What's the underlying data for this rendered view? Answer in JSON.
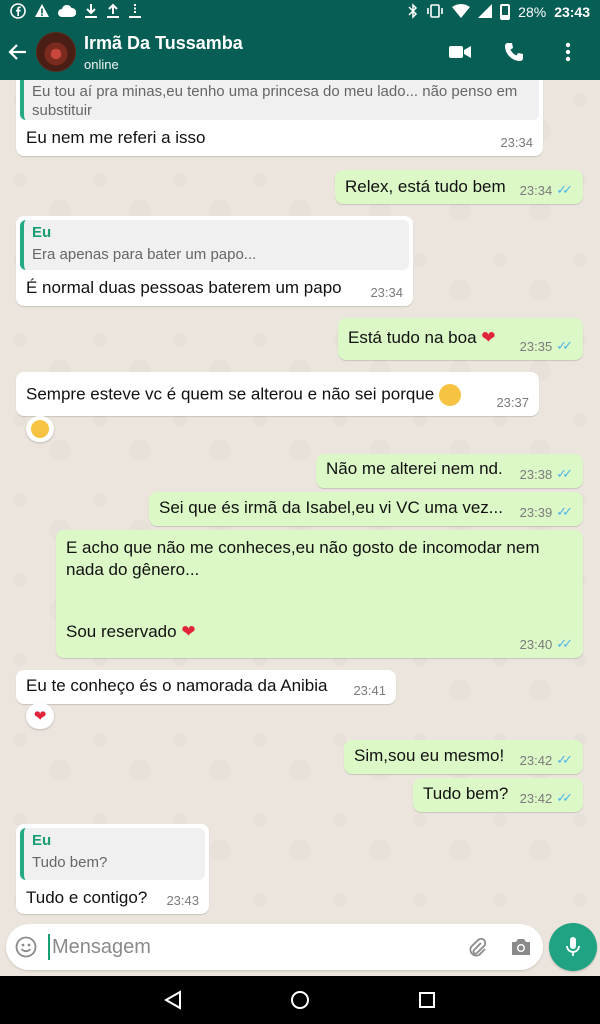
{
  "statusbar": {
    "battery": "28%",
    "time": "23:43",
    "left_icons": [
      "facebook-icon",
      "warning-icon",
      "cloud-icon",
      "download-icon",
      "download-icon",
      "upload-icon",
      "download-icon"
    ],
    "right_icons": [
      "bluetooth-icon",
      "vibrate-icon",
      "wifi-icon",
      "signal-icon",
      "battery-icon"
    ]
  },
  "header": {
    "contact_name": "Irmã Da Tussamba",
    "status": "online"
  },
  "messages": [
    {
      "type": "incoming",
      "quote_text": "Eu tou aí pra minas,eu tenho uma princesa do meu lado... não penso em substituir",
      "text": "Eu nem me referi a isso",
      "time": "23:34"
    },
    {
      "type": "outgoing",
      "text": "Relex, está tudo bem",
      "time": "23:34"
    },
    {
      "type": "incoming",
      "quote_name": "Eu",
      "quote_text": "Era apenas para bater um papo...",
      "text": "É normal duas pessoas baterem um papo",
      "time": "23:34"
    },
    {
      "type": "outgoing",
      "text": "Está tudo na boa",
      "time": "23:35"
    },
    {
      "type": "incoming",
      "text": "Sempre esteve vc é quem se alterou e não sei porque",
      "time": "23:37"
    },
    {
      "type": "outgoing",
      "text": "Não me alterei nem nd.",
      "time": "23:38"
    },
    {
      "type": "outgoing",
      "text": "Sei que és irmã da Isabel,eu vi VC uma vez...",
      "time": "23:39"
    },
    {
      "type": "outgoing",
      "text_line1": "E acho que não me conheces,eu não gosto de incomodar nem",
      "text_line2": "nada do gênero...",
      "text_line3": "Sou reservado",
      "time": "23:40"
    },
    {
      "type": "incoming",
      "text": "Eu te conheço és o namorada da Anibia",
      "time": "23:41"
    },
    {
      "type": "outgoing",
      "text": "Sim,sou eu mesmo!",
      "time": "23:42"
    },
    {
      "type": "outgoing",
      "text": "Tudo bem?",
      "time": "23:42"
    },
    {
      "type": "incoming",
      "quote_name": "Eu",
      "quote_text": "Tudo bem?",
      "text": "Tudo e contigo?",
      "time": "23:43"
    }
  ],
  "input": {
    "placeholder": "Mensagem"
  },
  "colors": {
    "header": "#075e54",
    "outgoing": "#dcf8c6",
    "incoming": "#ffffff",
    "accent": "#1fa383",
    "read_check": "#4fb6ec"
  }
}
